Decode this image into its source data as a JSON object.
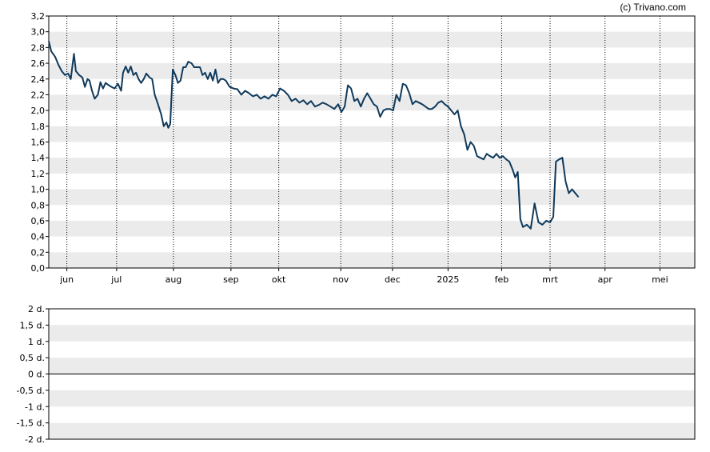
{
  "copyright": "(c) Trivano.com",
  "colors": {
    "line": "#0f3a5c",
    "band": "#ebebeb",
    "grid": "#000000",
    "frame": "#000000"
  },
  "chart_data": [
    {
      "type": "line",
      "ylim": [
        0,
        3.2
      ],
      "yticks": [
        "3,2",
        "3,0",
        "2,8",
        "2,6",
        "2,4",
        "2,2",
        "2,0",
        "1,8",
        "1,6",
        "1,4",
        "1,2",
        "1,0",
        "0,8",
        "0,6",
        "0,4",
        "0,2",
        "0,0"
      ],
      "xlim": [
        0,
        1
      ],
      "xticks": [
        {
          "label": "jun",
          "x": 0.028
        },
        {
          "label": "jul",
          "x": 0.105
        },
        {
          "label": "aug",
          "x": 0.193
        },
        {
          "label": "sep",
          "x": 0.282
        },
        {
          "label": "okt",
          "x": 0.356
        },
        {
          "label": "nov",
          "x": 0.452
        },
        {
          "label": "dec",
          "x": 0.532
        },
        {
          "label": "2025",
          "x": 0.618
        },
        {
          "label": "feb",
          "x": 0.701
        },
        {
          "label": "mrt",
          "x": 0.776
        },
        {
          "label": "apr",
          "x": 0.861
        },
        {
          "label": "mei",
          "x": 0.946
        }
      ],
      "grid": "vertical dotted at month starts, alternating horizontal bands",
      "series": [
        {
          "points": [
            [
              0.0,
              2.88
            ],
            [
              0.004,
              2.75
            ],
            [
              0.01,
              2.68
            ],
            [
              0.015,
              2.58
            ],
            [
              0.02,
              2.5
            ],
            [
              0.025,
              2.45
            ],
            [
              0.03,
              2.47
            ],
            [
              0.034,
              2.4
            ],
            [
              0.039,
              2.72
            ],
            [
              0.042,
              2.5
            ],
            [
              0.047,
              2.45
            ],
            [
              0.052,
              2.42
            ],
            [
              0.056,
              2.3
            ],
            [
              0.06,
              2.4
            ],
            [
              0.063,
              2.38
            ],
            [
              0.067,
              2.25
            ],
            [
              0.071,
              2.15
            ],
            [
              0.076,
              2.2
            ],
            [
              0.08,
              2.36
            ],
            [
              0.084,
              2.28
            ],
            [
              0.088,
              2.35
            ],
            [
              0.093,
              2.32
            ],
            [
              0.097,
              2.3
            ],
            [
              0.102,
              2.28
            ],
            [
              0.107,
              2.34
            ],
            [
              0.112,
              2.25
            ],
            [
              0.115,
              2.48
            ],
            [
              0.119,
              2.56
            ],
            [
              0.123,
              2.48
            ],
            [
              0.127,
              2.56
            ],
            [
              0.131,
              2.45
            ],
            [
              0.135,
              2.48
            ],
            [
              0.139,
              2.4
            ],
            [
              0.143,
              2.35
            ],
            [
              0.147,
              2.4
            ],
            [
              0.151,
              2.47
            ],
            [
              0.156,
              2.42
            ],
            [
              0.16,
              2.4
            ],
            [
              0.164,
              2.2
            ],
            [
              0.169,
              2.08
            ],
            [
              0.174,
              1.95
            ],
            [
              0.178,
              1.8
            ],
            [
              0.182,
              1.85
            ],
            [
              0.185,
              1.78
            ],
            [
              0.188,
              1.83
            ],
            [
              0.192,
              2.52
            ],
            [
              0.196,
              2.45
            ],
            [
              0.2,
              2.35
            ],
            [
              0.204,
              2.38
            ],
            [
              0.208,
              2.55
            ],
            [
              0.212,
              2.55
            ],
            [
              0.216,
              2.62
            ],
            [
              0.221,
              2.6
            ],
            [
              0.225,
              2.55
            ],
            [
              0.23,
              2.55
            ],
            [
              0.234,
              2.55
            ],
            [
              0.238,
              2.45
            ],
            [
              0.242,
              2.48
            ],
            [
              0.246,
              2.4
            ],
            [
              0.25,
              2.48
            ],
            [
              0.254,
              2.38
            ],
            [
              0.258,
              2.52
            ],
            [
              0.262,
              2.35
            ],
            [
              0.266,
              2.4
            ],
            [
              0.27,
              2.4
            ],
            [
              0.274,
              2.38
            ],
            [
              0.28,
              2.3
            ],
            [
              0.286,
              2.28
            ],
            [
              0.292,
              2.27
            ],
            [
              0.298,
              2.2
            ],
            [
              0.304,
              2.25
            ],
            [
              0.31,
              2.22
            ],
            [
              0.316,
              2.18
            ],
            [
              0.322,
              2.2
            ],
            [
              0.328,
              2.15
            ],
            [
              0.334,
              2.18
            ],
            [
              0.34,
              2.15
            ],
            [
              0.346,
              2.2
            ],
            [
              0.352,
              2.18
            ],
            [
              0.358,
              2.28
            ],
            [
              0.364,
              2.25
            ],
            [
              0.37,
              2.2
            ],
            [
              0.376,
              2.12
            ],
            [
              0.382,
              2.15
            ],
            [
              0.388,
              2.1
            ],
            [
              0.394,
              2.13
            ],
            [
              0.4,
              2.08
            ],
            [
              0.406,
              2.12
            ],
            [
              0.412,
              2.05
            ],
            [
              0.418,
              2.07
            ],
            [
              0.424,
              2.1
            ],
            [
              0.43,
              2.08
            ],
            [
              0.436,
              2.05
            ],
            [
              0.442,
              2.02
            ],
            [
              0.448,
              2.08
            ],
            [
              0.453,
              1.98
            ],
            [
              0.458,
              2.05
            ],
            [
              0.463,
              2.32
            ],
            [
              0.468,
              2.28
            ],
            [
              0.473,
              2.12
            ],
            [
              0.478,
              2.15
            ],
            [
              0.483,
              2.05
            ],
            [
              0.488,
              2.15
            ],
            [
              0.493,
              2.22
            ],
            [
              0.498,
              2.15
            ],
            [
              0.503,
              2.08
            ],
            [
              0.508,
              2.05
            ],
            [
              0.513,
              1.92
            ],
            [
              0.518,
              2.0
            ],
            [
              0.523,
              2.02
            ],
            [
              0.528,
              2.02
            ],
            [
              0.533,
              2.0
            ],
            [
              0.538,
              2.2
            ],
            [
              0.543,
              2.12
            ],
            [
              0.548,
              2.34
            ],
            [
              0.553,
              2.32
            ],
            [
              0.558,
              2.22
            ],
            [
              0.563,
              2.08
            ],
            [
              0.568,
              2.12
            ],
            [
              0.573,
              2.1
            ],
            [
              0.578,
              2.08
            ],
            [
              0.583,
              2.05
            ],
            [
              0.588,
              2.02
            ],
            [
              0.593,
              2.02
            ],
            [
              0.598,
              2.05
            ],
            [
              0.603,
              2.1
            ],
            [
              0.608,
              2.12
            ],
            [
              0.613,
              2.08
            ],
            [
              0.618,
              2.05
            ],
            [
              0.623,
              2.0
            ],
            [
              0.628,
              1.95
            ],
            [
              0.633,
              2.0
            ],
            [
              0.638,
              1.8
            ],
            [
              0.643,
              1.7
            ],
            [
              0.648,
              1.5
            ],
            [
              0.653,
              1.6
            ],
            [
              0.658,
              1.55
            ],
            [
              0.663,
              1.42
            ],
            [
              0.668,
              1.4
            ],
            [
              0.673,
              1.38
            ],
            [
              0.678,
              1.45
            ],
            [
              0.683,
              1.42
            ],
            [
              0.688,
              1.4
            ],
            [
              0.693,
              1.45
            ],
            [
              0.698,
              1.4
            ],
            [
              0.703,
              1.42
            ],
            [
              0.708,
              1.38
            ],
            [
              0.713,
              1.35
            ],
            [
              0.718,
              1.25
            ],
            [
              0.722,
              1.15
            ],
            [
              0.726,
              1.22
            ],
            [
              0.73,
              0.62
            ],
            [
              0.734,
              0.52
            ],
            [
              0.74,
              0.55
            ],
            [
              0.746,
              0.5
            ],
            [
              0.752,
              0.82
            ],
            [
              0.758,
              0.58
            ],
            [
              0.764,
              0.55
            ],
            [
              0.77,
              0.6
            ],
            [
              0.776,
              0.58
            ],
            [
              0.781,
              0.65
            ],
            [
              0.785,
              1.35
            ],
            [
              0.79,
              1.38
            ],
            [
              0.795,
              1.4
            ],
            [
              0.8,
              1.1
            ],
            [
              0.805,
              0.95
            ],
            [
              0.81,
              1.0
            ],
            [
              0.815,
              0.95
            ],
            [
              0.82,
              0.9
            ]
          ]
        }
      ]
    },
    {
      "type": "line",
      "ylim": [
        -2,
        2
      ],
      "yticks": [
        "2 d.",
        "1,5 d.",
        "1 d.",
        "0,5 d.",
        "0 d.",
        "-0,5 d.",
        "-1 d.",
        "-1,5 d.",
        "-2 d."
      ],
      "series": []
    }
  ]
}
